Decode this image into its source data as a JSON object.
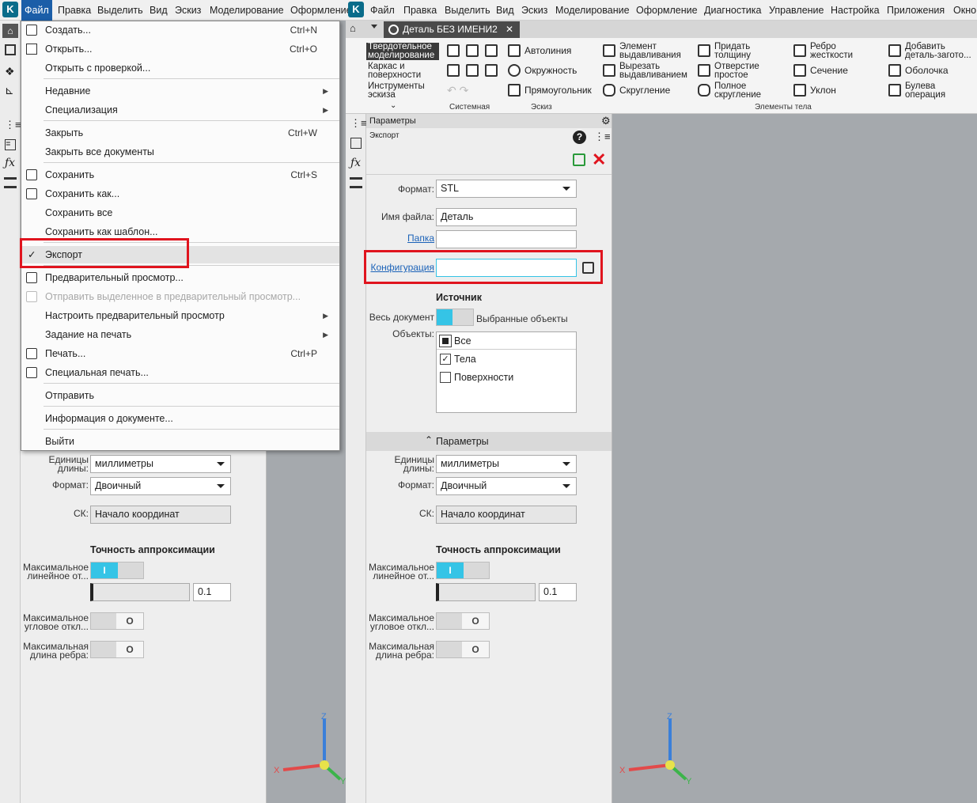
{
  "menubar": {
    "items": [
      "Файл",
      "Правка",
      "Выделить",
      "Вид",
      "Эскиз",
      "Моделирование",
      "Оформление"
    ],
    "items2": [
      "Файл",
      "Правка",
      "Выделить",
      "Вид",
      "Эскиз",
      "Моделирование",
      "Оформление",
      "Диагностика",
      "Управление",
      "Настройка",
      "Приложения",
      "Окно"
    ]
  },
  "tab": {
    "title": "Деталь БЕЗ ИМЕНИ2",
    "close": "✕"
  },
  "ribbon": {
    "modes": [
      "Твердотельное моделирование",
      "Каркас и поверхности",
      "Инструменты эскиза"
    ],
    "sketch": [
      "Автолиния",
      "Окружность",
      "Прямоугольник"
    ],
    "body": [
      "Элемент выдавливания",
      "Вырезать выдавливанием",
      "Скругление",
      "Придать толщину",
      "Отверстие простое",
      "Полное скругление",
      "Ребро жесткости",
      "Сечение",
      "Уклон",
      "Добавить деталь-загото...",
      "Оболочка",
      "Булева операция"
    ],
    "groups": [
      "Системная",
      "Эскиз",
      "Элементы тела"
    ]
  },
  "file_menu": [
    {
      "label": "Создать...",
      "shortcut": "Ctrl+N"
    },
    {
      "label": "Открыть...",
      "shortcut": "Ctrl+O"
    },
    {
      "label": "Открыть с проверкой..."
    },
    {
      "label": "Недавние"
    },
    {
      "label": "Специализация"
    },
    {
      "label": "Закрыть",
      "shortcut": "Ctrl+W"
    },
    {
      "label": "Закрыть все документы"
    },
    {
      "label": "Сохранить",
      "shortcut": "Ctrl+S"
    },
    {
      "label": "Сохранить как..."
    },
    {
      "label": "Сохранить все"
    },
    {
      "label": "Сохранить как шаблон..."
    },
    {
      "label": "Экспорт"
    },
    {
      "label": "Предварительный просмотр..."
    },
    {
      "label": "Отправить выделенное в предварительный просмотр..."
    },
    {
      "label": "Настроить предварительный просмотр"
    },
    {
      "label": "Задание на печать"
    },
    {
      "label": "Печать...",
      "shortcut": "Ctrl+P"
    },
    {
      "label": "Специальная печать..."
    },
    {
      "label": "Отправить"
    },
    {
      "label": "Информация о документе..."
    },
    {
      "label": "Выйти"
    }
  ],
  "params": {
    "title": "Параметры",
    "subtitle": "Экспорт",
    "format_label": "Формат:",
    "format": "STL",
    "filename_label": "Имя файла:",
    "filename": "Деталь",
    "folder_label": "Папка",
    "config_label": "Конфигурация",
    "source_title": "Источник",
    "whole_doc": "Весь документ",
    "selected": "Выбранные объекты",
    "objects_label": "Объекты:",
    "objects": [
      "Все",
      "Тела",
      "Поверхности"
    ],
    "params_section": "Параметры",
    "units_label": "Единицы длины:",
    "units": "миллиметры",
    "format2_label": "Формат:",
    "format2": "Двоичный",
    "cs_label": "СК:",
    "cs": "Начало координат",
    "accuracy_title": "Точность аппроксимации",
    "max_linear": "Максимальное линейное от...",
    "max_linear_value": "0.1",
    "max_angle": "Максимальное угловое откл...",
    "max_edge": "Максимальная длина ребра:",
    "toggle_on": "I",
    "toggle_off": "O"
  },
  "axes": {
    "x": "X",
    "y": "Y",
    "z": "Z"
  }
}
